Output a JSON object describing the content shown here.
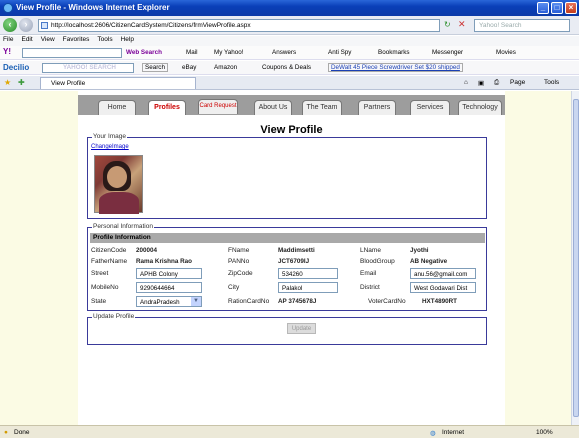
{
  "window": {
    "title": "View Profile - Windows Internet Explorer",
    "minimize": "_",
    "maximize": "□",
    "close": "×"
  },
  "addressbar": {
    "url": "http://localhost:2606/CitizenCardSystem/Citizens/frmViewProfile.aspx",
    "search_placeholder": "Yahoo! Search"
  },
  "menubar": {
    "items": [
      "File",
      "Edit",
      "View",
      "Favorites",
      "Tools",
      "Help"
    ]
  },
  "yahoo_toolbar": {
    "logo": "Y!",
    "web_search": "Web Search",
    "mail": "Mail",
    "my_yahoo": "My Yahoo!",
    "answers": "Answers",
    "anti_spy": "Anti Spy",
    "bookmarks": "Bookmarks",
    "messenger": "Messenger",
    "movies": "Movies"
  },
  "decilio_toolbar": {
    "logo": "Decilio",
    "search_logo": "YAHOO! SEARCH",
    "search_button": "Search",
    "ebay": "eBay",
    "amazon": "Amazon",
    "coupons": "Coupons & Deals",
    "promo": "DeWalt 45 Piece Screwdriver Set $20 shipped"
  },
  "tabbar": {
    "tab_title": "View Profile",
    "page_menu": "Page",
    "tools_menu": "Tools"
  },
  "site_nav": {
    "tabs": [
      "Home",
      "Profiles",
      "Card Request",
      "About Us",
      "The Team",
      "Partners",
      "Services",
      "Technology"
    ]
  },
  "page": {
    "title": "View Profile"
  },
  "image_section": {
    "legend": "Your Image",
    "change_link": "ChangeImage"
  },
  "personal_section": {
    "legend": "Personal Information",
    "header": "Profile Information",
    "citizen_code_label": "CitizenCode",
    "citizen_code": "200004",
    "fname_label": "FName",
    "fname": "Maddimsetti",
    "lname_label": "LName",
    "lname": "Jyothi",
    "father_label": "FatherName",
    "father": "Rama Krishna Rao",
    "pan_label": "PANNo",
    "pan": "JCT6709IJ",
    "blood_label": "BloodGroup",
    "blood": "AB Negative",
    "street_label": "Street",
    "street": "APHB Colony",
    "zip_label": "ZipCode",
    "zip": "534260",
    "email_label": "Email",
    "email": "anu.56@gmail.com",
    "mobile_label": "MobileNo",
    "mobile": "9290644664",
    "city_label": "City",
    "city": "Palakol",
    "district_label": "District",
    "district": "West Godavari Dist",
    "state_label": "State",
    "state": "AndraPradesh",
    "ration_label": "RationCardNo",
    "ration": "AP 3745678J",
    "voter_label": "VoterCardNo",
    "voter": "HXT4890RT"
  },
  "update_section": {
    "legend": "Update Profile",
    "button": "Update"
  },
  "statusbar": {
    "left": "Done",
    "zone": "Internet",
    "zoom": "100%"
  }
}
